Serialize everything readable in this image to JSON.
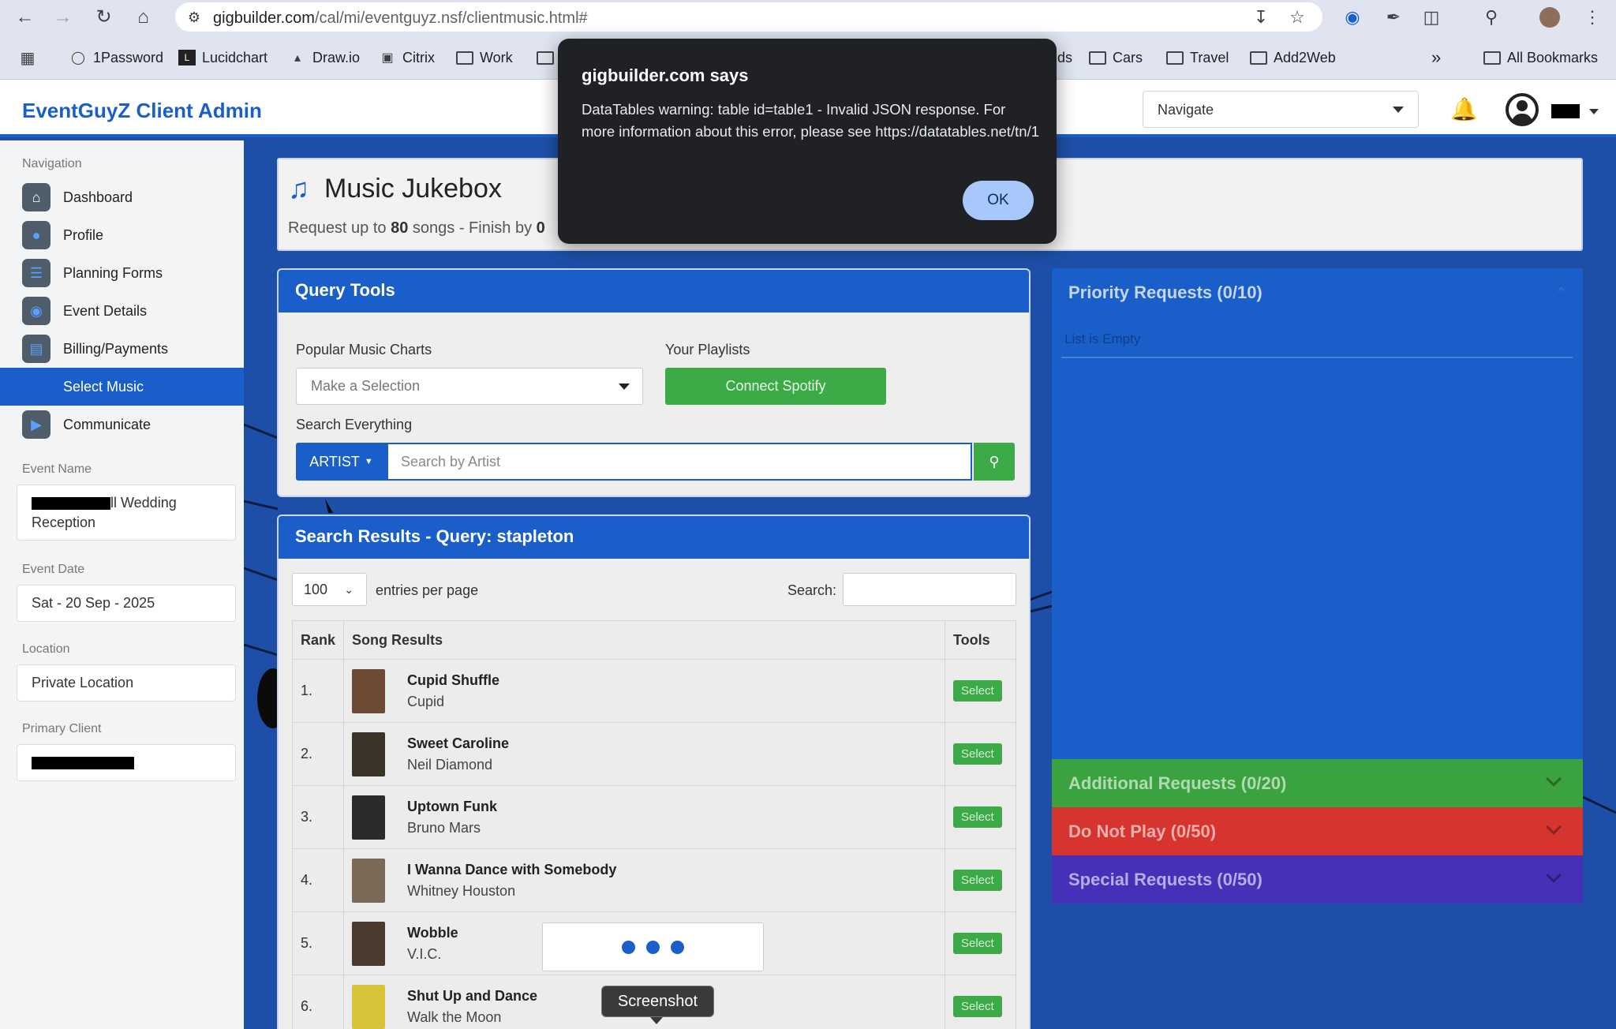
{
  "browser": {
    "url_host": "gigbuilder.com",
    "url_path": "/cal/mi/eventguyz.nsf/clientmusic.html#",
    "bookmarks": [
      "1Password",
      "Lucidchart",
      "Draw.io",
      "Citrix",
      "Work",
      "ds",
      "Cars",
      "Travel",
      "Add2Web",
      "All Bookmarks"
    ],
    "more_label": "»"
  },
  "header": {
    "brand": "EventGuyZ Client Admin",
    "navigate_label": "Navigate"
  },
  "sidebar": {
    "heading": "Navigation",
    "items": [
      {
        "label": "Dashboard",
        "icon": "home-icon"
      },
      {
        "label": "Profile",
        "icon": "user-icon"
      },
      {
        "label": "Planning Forms",
        "icon": "list-icon"
      },
      {
        "label": "Event Details",
        "icon": "map-pin-icon"
      },
      {
        "label": "Billing/Payments",
        "icon": "money-icon"
      },
      {
        "label": "Select Music",
        "icon": "music-icon"
      },
      {
        "label": "Communicate",
        "icon": "megaphone-icon"
      }
    ],
    "event_name_label": "Event Name",
    "event_name_value_1": "ll Wedding",
    "event_name_value_2": "Reception",
    "event_date_label": "Event Date",
    "event_date_value": "Sat - 20 Sep - 2025",
    "location_label": "Location",
    "location_value": "Private Location",
    "primary_client_label": "Primary Client"
  },
  "jukebox": {
    "title": "Music Jukebox",
    "sub_prefix": "Request up to",
    "sub_count": "80",
    "sub_suffix": "songs - Finish by",
    "sub_cut": "0"
  },
  "query": {
    "title": "Query Tools",
    "charts_label": "Popular Music Charts",
    "charts_placeholder": "Make a Selection",
    "playlists_label": "Your Playlists",
    "spotify_label": "Connect Spotify",
    "search_label": "Search Everything",
    "artist_label": "ARTIST",
    "search_placeholder": "Search by Artist"
  },
  "results": {
    "title": "Search Results - Query: stapleton",
    "entries_value": "100",
    "entries_label": "entries per page",
    "search_label": "Search:",
    "columns": [
      "Rank",
      "Song Results",
      "Tools"
    ],
    "select_label": "Select",
    "rows": [
      {
        "rank": "1.",
        "title": "Cupid Shuffle",
        "artist": "Cupid",
        "thumb": "#6d4a35"
      },
      {
        "rank": "2.",
        "title": "Sweet Caroline",
        "artist": "Neil Diamond",
        "thumb": "#3a3328"
      },
      {
        "rank": "3.",
        "title": "Uptown Funk",
        "artist": "Bruno Mars",
        "thumb": "#2b2b2b"
      },
      {
        "rank": "4.",
        "title": "I Wanna Dance with Somebody",
        "artist": "Whitney Houston",
        "thumb": "#7b6a58"
      },
      {
        "rank": "5.",
        "title": "Wobble",
        "artist": "V.I.C.",
        "thumb": "#4a3a30"
      },
      {
        "rank": "6.",
        "title": "Shut Up and Dance",
        "artist": "Walk the Moon",
        "thumb": "#d8c23a"
      }
    ]
  },
  "priority": {
    "title": "Priority Requests (0/10)",
    "empty": "List is Empty"
  },
  "accordions": [
    {
      "label": "Additional Requests (0/20)",
      "color": "#3aa33f"
    },
    {
      "label": "Do Not Play (0/50)",
      "color": "#d5352e"
    },
    {
      "label": "Special Requests (0/50)",
      "color": "#4630b8"
    }
  ],
  "dialog": {
    "title": "gigbuilder.com says",
    "message": "DataTables warning: table id=table1 - Invalid JSON response. For more information about this error, please see https://datatables.net/tn/1",
    "ok_label": "OK"
  },
  "tooltip": "Screenshot",
  "colors": {
    "brand_blue": "#1a5fc9",
    "success_green": "#3cab47"
  }
}
